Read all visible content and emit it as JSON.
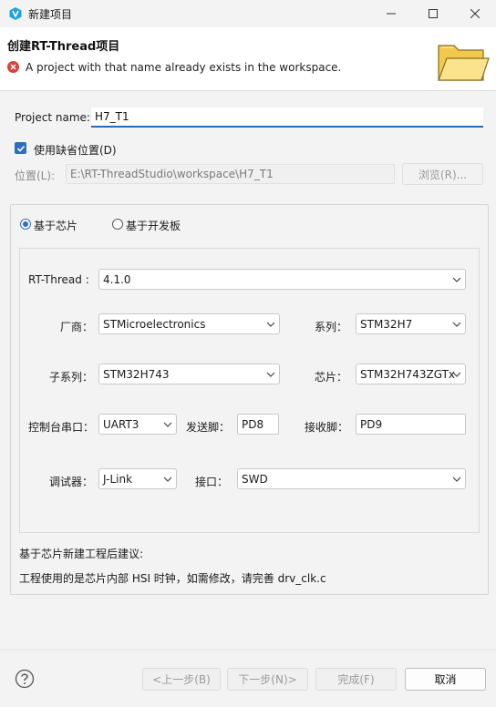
{
  "window": {
    "title": "新建项目",
    "app_icon": "rt-thread-studio-icon"
  },
  "header": {
    "title": "创建RT-Thread项目",
    "error_message": "A project with that name already exists in the workspace."
  },
  "project_name": {
    "label": "Project name:",
    "value": "H7_T1"
  },
  "default_location": {
    "label": "使用缺省位置(D)",
    "checked": true
  },
  "location": {
    "label": "位置(L):",
    "value": "E:\\RT-ThreadStudio\\workspace\\H7_T1",
    "browse_label": "浏览(R)..."
  },
  "mode": {
    "chip_label": "基于芯片",
    "board_label": "基于开发板",
    "selected": "chip"
  },
  "config": {
    "rtthread_label": "RT-Thread :",
    "rtthread_value": "4.1.0",
    "vendor_label": "厂商：",
    "vendor_value": "STMicroelectronics",
    "series_label": "系列：",
    "series_value": "STM32H7",
    "subseries_label": "子系列：",
    "subseries_value": "STM32H743",
    "chip_label": "芯片：",
    "chip_value": "STM32H743ZGTx",
    "console_label": "控制台串口：",
    "console_value": "UART3",
    "tx_label": "发送脚：",
    "tx_value": "PD8",
    "rx_label": "接收脚：",
    "rx_value": "PD9",
    "debugger_label": "调试器：",
    "debugger_value": "J-Link",
    "interface_label": "接口：",
    "interface_value": "SWD"
  },
  "advice": {
    "title": "基于芯片新建工程后建议:",
    "text": "工程使用的是芯片内部 HSI 时钟，如需修改，请完善 drv_clk.c"
  },
  "buttons": {
    "back": "<上一步(B)",
    "next": "下一步(N)>",
    "finish": "完成(F)",
    "cancel": "取消"
  },
  "colors": {
    "accent": "#2d6ec3",
    "error": "#d9413a",
    "input_focus": "#2a69b5"
  }
}
